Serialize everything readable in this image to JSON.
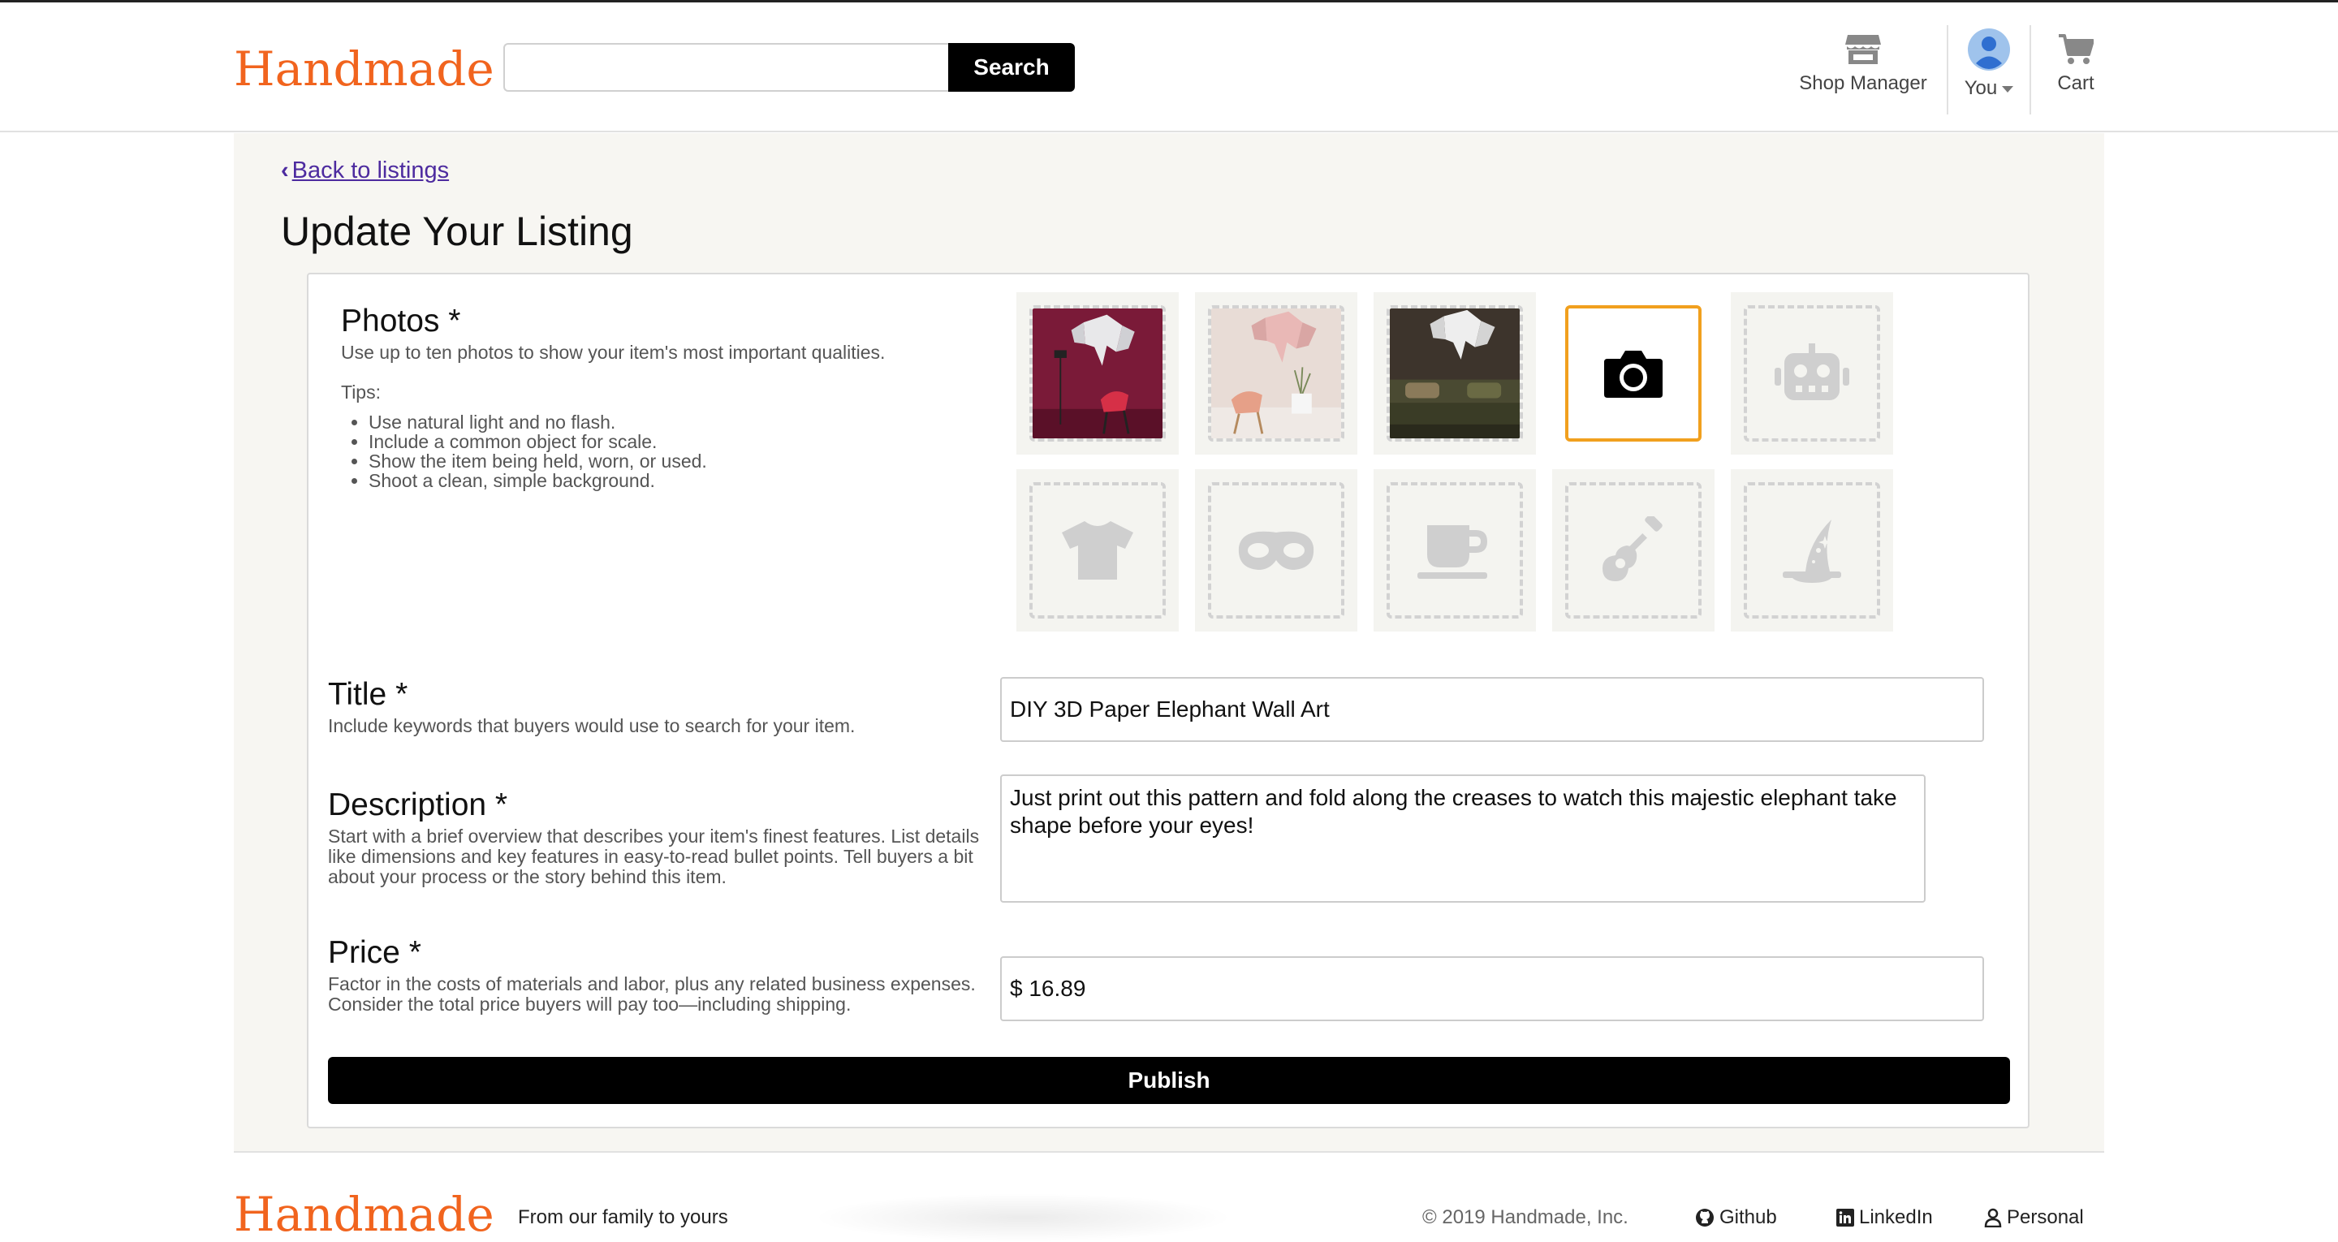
{
  "header": {
    "logo": "Handmade",
    "search_value": "",
    "search_button": "Search",
    "nav": {
      "shop_manager": "Shop Manager",
      "you": "You",
      "cart": "Cart"
    }
  },
  "main": {
    "back_link": "Back to listings",
    "page_title": "Update Your Listing",
    "photos": {
      "title": "Photos *",
      "description": "Use up to ten photos to show your item's most important qualities.",
      "tips_label": "Tips:",
      "tips": [
        "Use natural light and no flash.",
        "Include a common object for scale.",
        "Show the item being held, worn, or used.",
        "Shoot a clean, simple background."
      ],
      "slots": [
        {
          "type": "photo",
          "name": "elephant-photo-burgundy"
        },
        {
          "type": "photo",
          "name": "elephant-photo-pink"
        },
        {
          "type": "photo",
          "name": "elephant-photo-dark"
        },
        {
          "type": "camera",
          "name": "camera-icon"
        },
        {
          "type": "placeholder",
          "name": "robot-icon"
        },
        {
          "type": "placeholder",
          "name": "tshirt-icon"
        },
        {
          "type": "placeholder",
          "name": "mask-icon"
        },
        {
          "type": "placeholder",
          "name": "mug-icon"
        },
        {
          "type": "placeholder",
          "name": "guitar-icon"
        },
        {
          "type": "placeholder",
          "name": "wizard-hat-icon"
        }
      ]
    },
    "title_field": {
      "label": "Title *",
      "description": "Include keywords that buyers would use to search for your item.",
      "value": "DIY 3D Paper Elephant Wall Art"
    },
    "description_field": {
      "label": "Description *",
      "description": "Start with a brief overview that describes your item's finest features. List details like dimensions and key features in easy-to-read bullet points. Tell buyers a bit about your process or the story behind this item.",
      "value": "Just print out this pattern and fold along the creases to watch this majestic elephant take shape before your eyes!"
    },
    "price_field": {
      "label": "Price *",
      "description": "Factor in the costs of materials and labor, plus any related business expenses. Consider the total price buyers will pay too—including shipping.",
      "value": "$ 16.89"
    },
    "publish_button": "Publish"
  },
  "footer": {
    "logo": "Handmade",
    "tagline": "From our family to yours",
    "copyright": "© 2019 Handmade, Inc.",
    "links": {
      "github": "Github",
      "linkedin": "LinkedIn",
      "personal": "Personal"
    }
  },
  "colors": {
    "brand": "#f1641e",
    "active_slot_border": "#f1a01e",
    "link": "#4d2b9f"
  }
}
